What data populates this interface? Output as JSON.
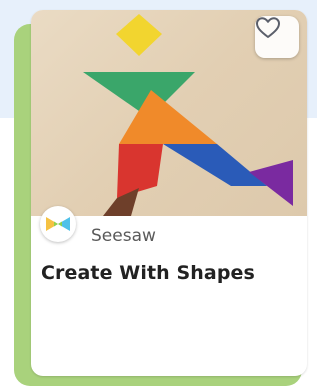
{
  "card": {
    "source": "Seesaw",
    "title": "Create With Shapes"
  },
  "icons": {
    "favorite": "heart-outline-icon",
    "source_logo": "seesaw-logo-icon"
  },
  "colors": {
    "frame_green": "#a9d27c",
    "top_band": "#e7f0fb"
  }
}
